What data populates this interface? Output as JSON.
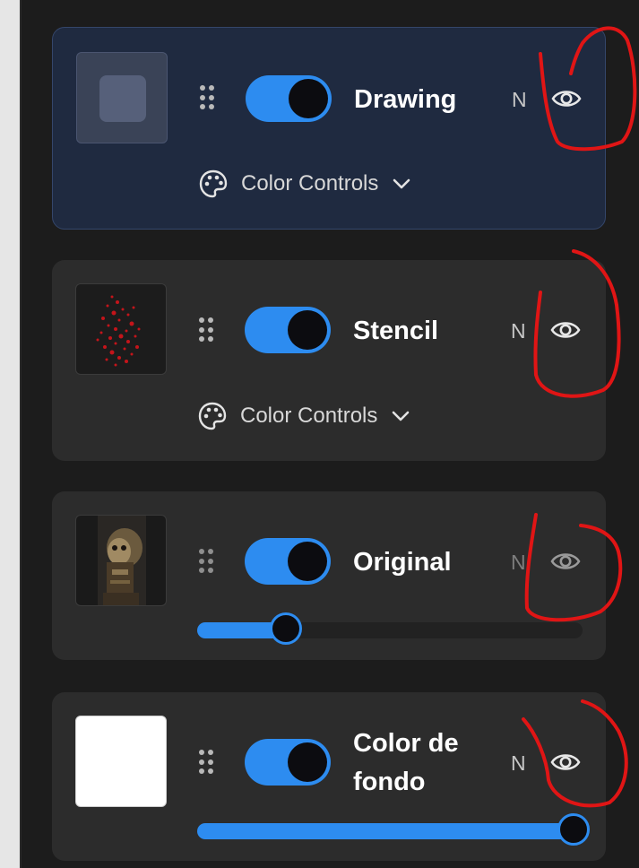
{
  "layers": [
    {
      "id": "drawing",
      "name": "Drawing",
      "enabled": true,
      "blend_mode": "N",
      "visible_icon": "eye-icon",
      "color_controls_label": "Color Controls",
      "active": true
    },
    {
      "id": "stencil",
      "name": "Stencil",
      "enabled": true,
      "blend_mode": "N",
      "visible_icon": "eye-icon",
      "color_controls_label": "Color Controls",
      "active": false
    },
    {
      "id": "original",
      "name": "Original",
      "enabled": true,
      "blend_mode": "N",
      "visible_icon": "eye-icon",
      "opacity": 0.23,
      "active": false
    },
    {
      "id": "background",
      "name_line1": "Color de",
      "name_line2": "fondo",
      "enabled": true,
      "blend_mode": "N",
      "visible_icon": "eye-icon",
      "opacity": 1.0,
      "swatch_color": "#ffffff",
      "active": false
    }
  ],
  "colors": {
    "accent": "#2d8cf0",
    "active_card": "#1f2a40",
    "card": "#2c2c2c",
    "annotation": "#e01515"
  },
  "icons": {
    "drag": "drag-handle-icon",
    "palette": "palette-icon",
    "chevron": "chevron-down-icon",
    "eye": "eye-icon"
  }
}
